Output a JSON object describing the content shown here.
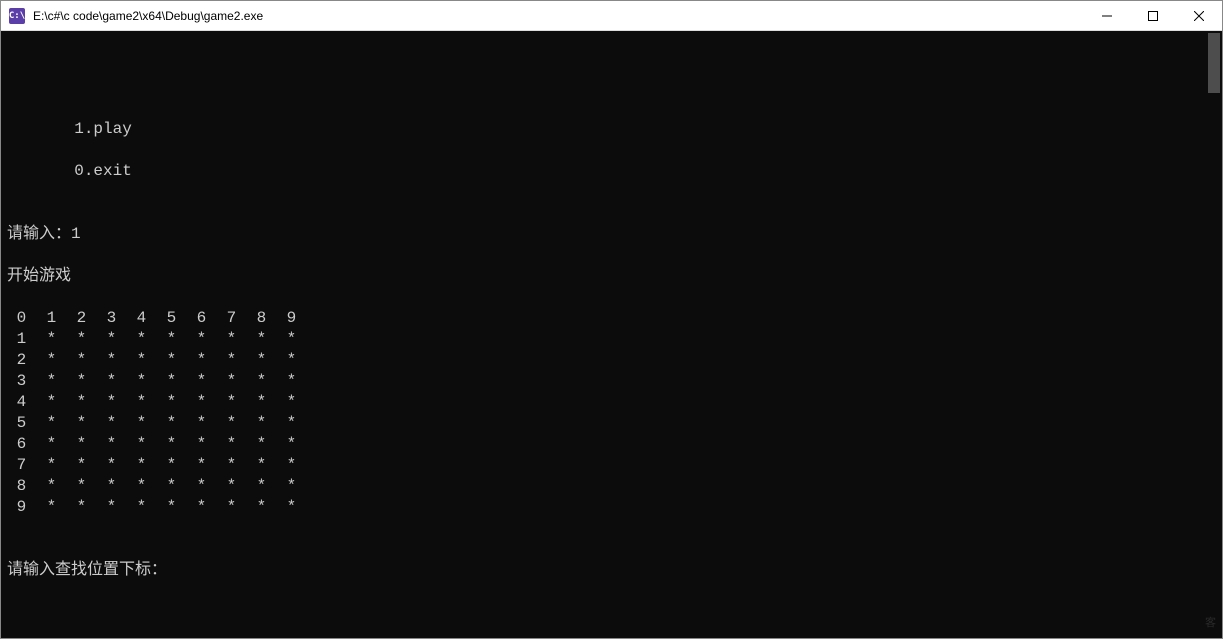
{
  "window": {
    "title": "E:\\c#\\c code\\game2\\x64\\Debug\\game2.exe",
    "icon_label": "C:\\"
  },
  "console": {
    "blank_top": "",
    "menu": {
      "line1": "       1.play",
      "line2": "       0.exit"
    },
    "blank_after_menu": "",
    "input_prompt": "请输入：1",
    "start_msg": "开始游戏",
    "grid": {
      "header": [
        "0",
        "1",
        "2",
        "3",
        "4",
        "5",
        "6",
        "7",
        "8",
        "9"
      ],
      "rows": [
        {
          "label": "1",
          "cells": [
            "*",
            "*",
            "*",
            "*",
            "*",
            "*",
            "*",
            "*",
            "*"
          ]
        },
        {
          "label": "2",
          "cells": [
            "*",
            "*",
            "*",
            "*",
            "*",
            "*",
            "*",
            "*",
            "*"
          ]
        },
        {
          "label": "3",
          "cells": [
            "*",
            "*",
            "*",
            "*",
            "*",
            "*",
            "*",
            "*",
            "*"
          ]
        },
        {
          "label": "4",
          "cells": [
            "*",
            "*",
            "*",
            "*",
            "*",
            "*",
            "*",
            "*",
            "*"
          ]
        },
        {
          "label": "5",
          "cells": [
            "*",
            "*",
            "*",
            "*",
            "*",
            "*",
            "*",
            "*",
            "*"
          ]
        },
        {
          "label": "6",
          "cells": [
            "*",
            "*",
            "*",
            "*",
            "*",
            "*",
            "*",
            "*",
            "*"
          ]
        },
        {
          "label": "7",
          "cells": [
            "*",
            "*",
            "*",
            "*",
            "*",
            "*",
            "*",
            "*",
            "*"
          ]
        },
        {
          "label": "8",
          "cells": [
            "*",
            "*",
            "*",
            "*",
            "*",
            "*",
            "*",
            "*",
            "*"
          ]
        },
        {
          "label": "9",
          "cells": [
            "*",
            "*",
            "*",
            "*",
            "*",
            "*",
            "*",
            "*",
            "*"
          ]
        }
      ]
    },
    "blank_after_grid": "",
    "coord_prompt": "请输入查找位置下标："
  },
  "watermark": "客"
}
